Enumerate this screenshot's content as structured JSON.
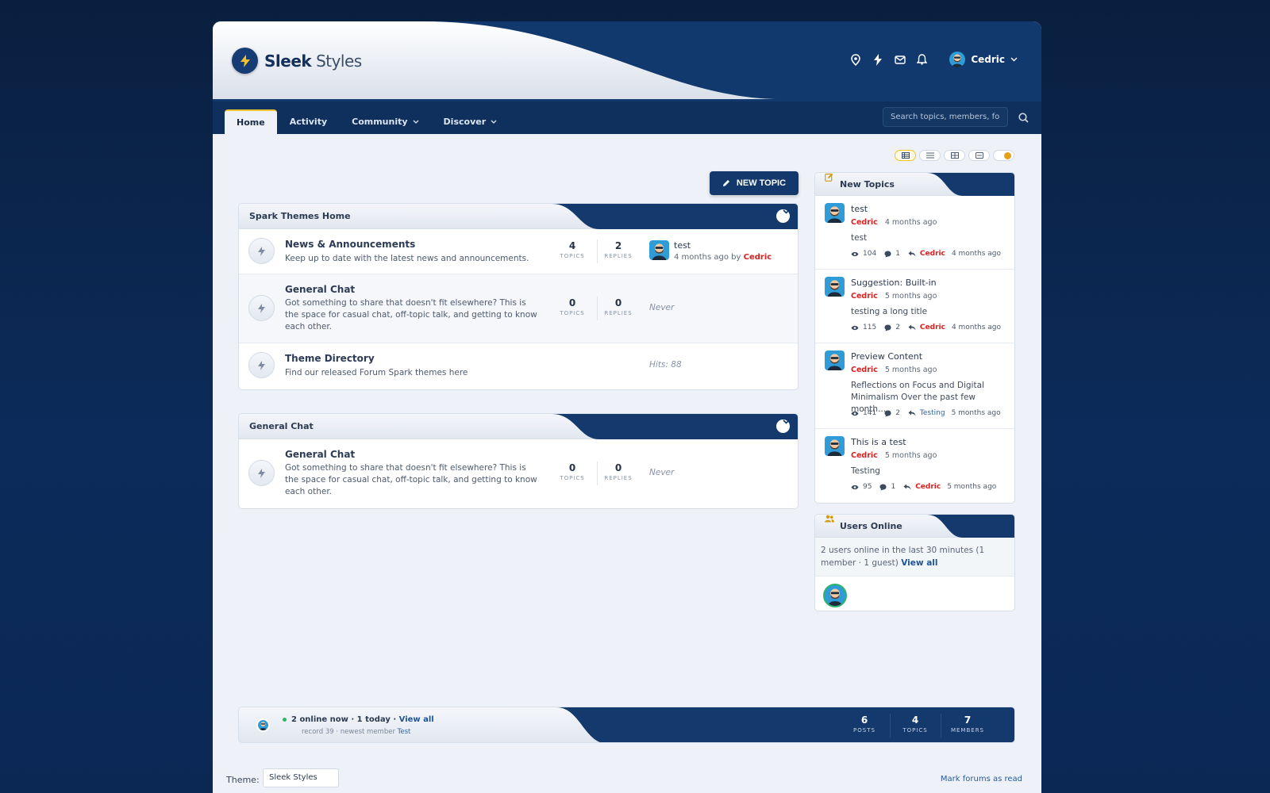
{
  "brand": {
    "name_bold": "Sleek",
    "name_light": "Styles"
  },
  "header": {
    "icons": [
      "map-pin-icon",
      "lightning-icon",
      "mail-icon",
      "bell-icon"
    ],
    "user": "Cedric"
  },
  "nav": {
    "tabs": [
      {
        "label": "Home",
        "active": true
      },
      {
        "label": "Activity"
      },
      {
        "label": "Community",
        "dropdown": true
      },
      {
        "label": "Discover",
        "dropdown": true
      }
    ],
    "search_placeholder": "Search topics, members, forums..."
  },
  "actions": {
    "new_topic": "NEW TOPIC"
  },
  "categories": [
    {
      "title": "Spark Themes Home",
      "forums": [
        {
          "title": "News & Announcements",
          "desc": "Keep up to date with the latest news and announcements.",
          "topics": "4",
          "replies": "2",
          "last_title": "test",
          "last_when": "4 months ago by",
          "last_user": "Cedric"
        },
        {
          "title": "General Chat",
          "desc": "Got something to share that doesn't fit elsewhere? This is the space for casual chat, off-topic talk, and getting to know each other.",
          "topics": "0",
          "replies": "0",
          "last": "Never"
        },
        {
          "title": "Theme Directory",
          "desc": "Find our released Forum Spark themes here",
          "last": "Hits: 88"
        }
      ]
    },
    {
      "title": "General Chat",
      "forums": [
        {
          "title": "General Chat",
          "desc": "Got something to share that doesn't fit elsewhere? This is the space for casual chat, off-topic talk, and getting to know each other.",
          "topics": "0",
          "replies": "0",
          "last": "Never"
        }
      ]
    }
  ],
  "labels": {
    "topics": "TOPICS",
    "replies": "REPLIES"
  },
  "new_topics": {
    "title": "New Topics",
    "items": [
      {
        "title": "test",
        "user": "Cedric",
        "when": "4 months ago",
        "excerpt": "test",
        "views": "104",
        "replies": "1",
        "last_user": "Cedric",
        "last_when": "4 months ago"
      },
      {
        "title": "Suggestion: Built-in",
        "user": "Cedric",
        "when": "5 months ago",
        "excerpt": "testing a long title",
        "views": "115",
        "replies": "2",
        "last_user": "Cedric",
        "last_when": "4 months ago"
      },
      {
        "title": "Preview Content",
        "user": "Cedric",
        "when": "5 months ago",
        "excerpt": "Reflections on Focus and Digital Minimalism Over the past few month...",
        "views": "141",
        "replies": "2",
        "last_user": "Testing",
        "last_when": "5 months ago"
      },
      {
        "title": "This is a test",
        "user": "Cedric",
        "when": "5 months ago",
        "excerpt": "Testing",
        "views": "95",
        "replies": "1",
        "last_user": "Cedric",
        "last_when": "5 months ago"
      }
    ]
  },
  "users_online": {
    "title": "Users Online",
    "text": "2 users online in the last 30 minutes (1 member · 1 guest)",
    "view_all": "View all"
  },
  "statbar": {
    "online_now": "2 online now · 1 today ·",
    "view_all": "View all",
    "record": "record 39 · newest member",
    "newest": "Test",
    "stats": [
      {
        "num": "6",
        "label": "POSTS"
      },
      {
        "num": "4",
        "label": "TOPICS"
      },
      {
        "num": "7",
        "label": "MEMBERS"
      }
    ]
  },
  "footer": {
    "theme_label": "Theme:",
    "theme_value": "Sleek Styles",
    "mark_read": "Mark forums as read"
  },
  "colors": {
    "primary": "#13386b",
    "accent": "#f1c232",
    "user_red": "#d72222",
    "online": "#2db36a"
  }
}
